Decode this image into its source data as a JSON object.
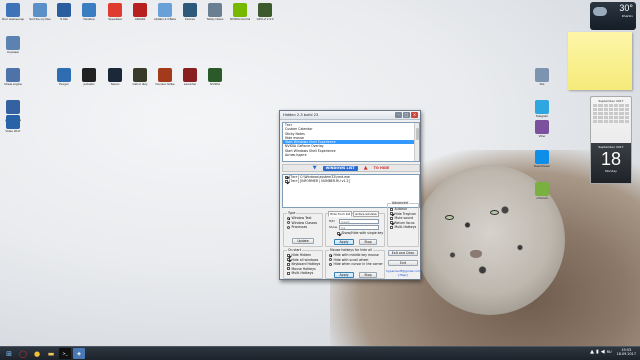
{
  "desktop": {
    "icons": [
      {
        "label": "Этот компьютер",
        "icon": "computer-icon",
        "color": "#3d74b8"
      },
      {
        "label": "Sort the my files",
        "icon": "folder-icon",
        "color": "#5b8fc8"
      },
      {
        "label": "S.Info",
        "icon": "info-icon",
        "color": "#2a5d9f"
      },
      {
        "label": "Desktop",
        "icon": "desktop-icon",
        "color": "#3a7dc0"
      },
      {
        "label": "Speedtest",
        "icon": "speedtest-icon",
        "color": "#e03b2f"
      },
      {
        "label": "AIDA64",
        "icon": "aida64-icon",
        "color": "#b82020"
      },
      {
        "label": "Hidden 2.3 Beta",
        "icon": "hidden-icon",
        "color": "#6aa0d8"
      },
      {
        "label": "Fences",
        "icon": "fences-icon",
        "color": "#2d5a7a"
      },
      {
        "label": "Sticky Notes",
        "icon": "sticky-icon",
        "color": "#6a7f92"
      },
      {
        "label": "NVIDIA Control",
        "icon": "nvidia-icon",
        "color": "#76b900"
      },
      {
        "label": "GPU-Z 2.3.0",
        "icon": "gpuz-icon",
        "color": "#3c5a2c"
      },
      {
        "label": "Корзина",
        "icon": "recycle-bin-icon",
        "color": "#5c82b2"
      },
      {
        "label": "Cheat engine",
        "icon": "cheat-engine-icon",
        "color": "#4d73a8"
      },
      {
        "label": "Ресурс",
        "icon": "resource-icon",
        "color": "#2f6db3"
      },
      {
        "label": "jetAudio",
        "icon": "jetaudio-icon",
        "color": "#222222"
      },
      {
        "label": "Steam",
        "icon": "steam-icon",
        "color": "#1b2838"
      },
      {
        "label": "Call of duty",
        "icon": "cod-icon",
        "color": "#3a3a2a"
      },
      {
        "label": "Counter-Strike",
        "icon": "cs-icon",
        "color": "#a33a1c"
      },
      {
        "label": "Launcher",
        "icon": "launcher-icon",
        "color": "#8a1f1f"
      },
      {
        "label": "NVIDIA",
        "icon": "nvidia2-icon",
        "color": "#2a5a2a"
      },
      {
        "label": "Панель управления",
        "icon": "control-panel-icon",
        "color": "#3462a0"
      },
      {
        "label": "Video 2017",
        "icon": "video-icon",
        "color": "#2a62a8"
      },
      {
        "label": "Telegram",
        "icon": "telegram-icon",
        "color": "#2ea6e0"
      },
      {
        "label": "Viber",
        "icon": "viber-icon",
        "color": "#7b519d"
      },
      {
        "label": "TeamViewer",
        "icon": "teamviewer-icon",
        "color": "#0e8ee9"
      },
      {
        "label": "uTorrent",
        "icon": "utorrent-icon",
        "color": "#78b13f"
      },
      {
        "label": "File",
        "icon": "file-icon",
        "color": "#7d94b0"
      }
    ]
  },
  "weather": {
    "temp": "30°",
    "city": "Kharkiv"
  },
  "calendar": {
    "month": "September 2017",
    "day": "18",
    "weekday": "Monday",
    "month2": "September 2017"
  },
  "window": {
    "title": "Hidden 2.3 build 23",
    "process_list": [
      "Тест",
      "Custom Calendar",
      "Sticky Notes",
      "Hide mouse",
      "Start Windows Shell Experience",
      "NVIDIA GeForce Overlay",
      "Start Windows Shell Experience",
      "Актив.Іздате"
    ],
    "selected_index": 4,
    "windows_list_label": "WINDOWS LIST",
    "to_hide_label": "TO HIDE",
    "hidden_list": [
      "[Тест] C:\\Windows\\system32\\cmd.exe",
      "[Тест] [INFORMER | NUMBER.RU v1.2]"
    ],
    "type": {
      "label": "Type",
      "options": [
        "Window Text",
        "Window Classes",
        "Processes"
      ],
      "update_label": "Update"
    },
    "hide_from": {
      "label": "Hide from list",
      "tab2": "Active window",
      "hk_label": "H/D",
      "hk_value": "Insert",
      "show_label": "Show",
      "show_value": "Ins",
      "single_key": "Show/Hide with single key",
      "apply_label": "Apply",
      "stop_label": "Stop"
    },
    "advanced": {
      "label": "Advanced",
      "options": [
        "Autorun",
        "Hide TrayIcon",
        "Mute sound",
        "Return focus",
        "Multi-Hotkeys"
      ],
      "checked": [
        false,
        true,
        false,
        true,
        false
      ],
      "exit_clear": "Exit and Clear",
      "exit": "Exit"
    },
    "on_start": {
      "label": "On start",
      "options": [
        "Hide Hidden",
        "Hide all windows",
        "Keyboard Hotkeys",
        "Mouse Hotkeys",
        "Multi-Hotkeys"
      ],
      "checked": [
        true,
        true,
        false,
        false,
        false
      ]
    },
    "mouse_hotkey": {
      "label": "Mouse hotkeys for hide all",
      "options": [
        "Hide with middle key mouse",
        "Hide with scroll wheel",
        "Hide when cursor in the corner"
      ],
      "selected": 0,
      "apply_label": "Apply",
      "stop_label": "Stop"
    },
    "footer_link": "hyperosoft@gmail.com",
    "help_label": "[Help]"
  },
  "taskbar": {
    "items": [
      "start-icon",
      "opera-icon",
      "chrome-icon",
      "explorer-icon",
      "cmd-icon",
      "hidden-icon"
    ],
    "time": "19:53",
    "date": "18.09.2017",
    "lang": "RU"
  }
}
